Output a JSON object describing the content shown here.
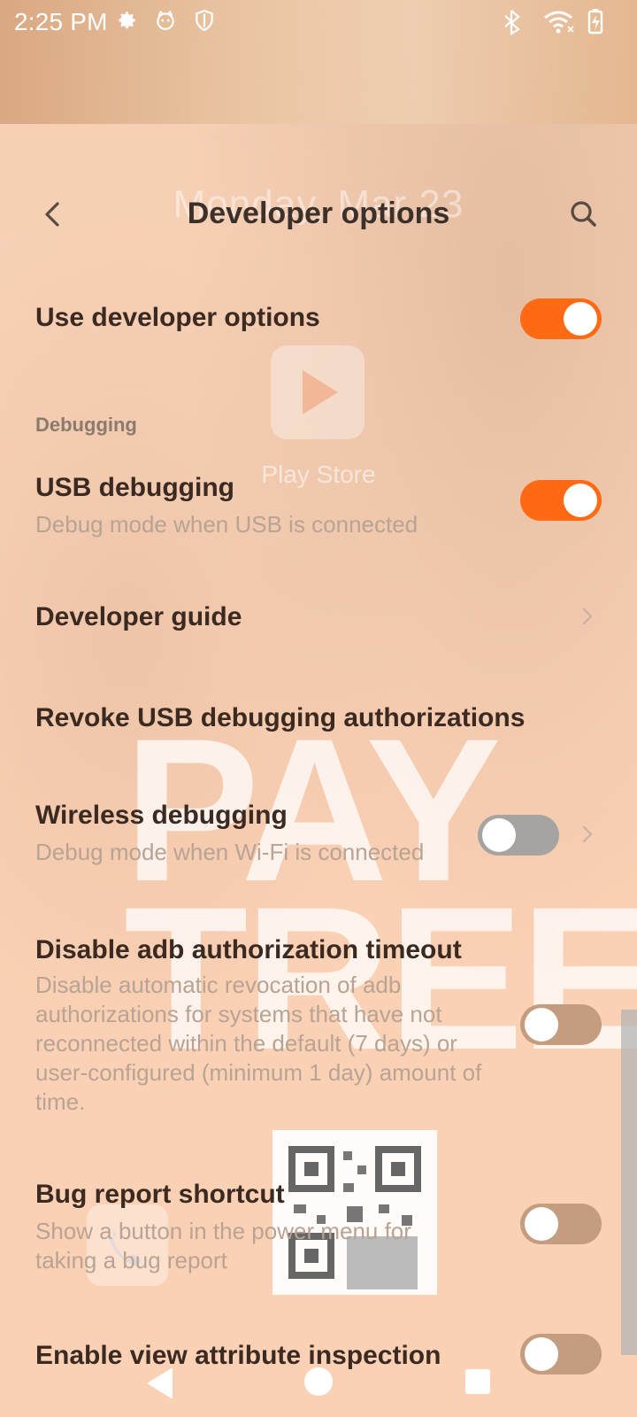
{
  "status_bar": {
    "time": "2:25 PM",
    "left_icons": [
      "gear-icon",
      "cat-face-icon",
      "shield-icon"
    ],
    "right_icons": [
      "bluetooth-icon",
      "wifi-icon",
      "battery-charging-icon"
    ]
  },
  "header": {
    "title": "Developer options",
    "ghost_date": "Monday, Mar 23"
  },
  "settings": {
    "use_developer_options": {
      "title": "Use developer options",
      "state": "on"
    },
    "debugging_section": "Debugging",
    "usb_debugging": {
      "title": "USB debugging",
      "subtitle": "Debug mode when USB is connected",
      "state": "on"
    },
    "developer_guide": {
      "title": "Developer guide"
    },
    "revoke_usb": {
      "title": "Revoke USB debugging authorizations"
    },
    "wireless_debugging": {
      "title": "Wireless debugging",
      "subtitle": "Debug mode when Wi-Fi is connected",
      "state": "off"
    },
    "disable_adb_timeout": {
      "title": "Disable adb authorization timeout",
      "subtitle": "Disable automatic revocation of adb authorizations for systems that have not reconnected within the default (7 days) or user-configured (minimum 1 day) amount of time.",
      "state": "off"
    },
    "bug_report_shortcut": {
      "title": "Bug report shortcut",
      "subtitle": "Show a button in the power menu for taking a bug report",
      "state": "off"
    },
    "view_attribute_inspection": {
      "title": "Enable view attribute inspection",
      "state": "off"
    }
  },
  "ghost": {
    "app_label": "Play Store",
    "watermark_line1": "PAY",
    "watermark_line2": "TREE"
  },
  "colors": {
    "accent": "#ff6a12",
    "toggle_off": "#c49c80",
    "title_text": "#3a2a22",
    "subtitle_text": "#b8a394"
  }
}
